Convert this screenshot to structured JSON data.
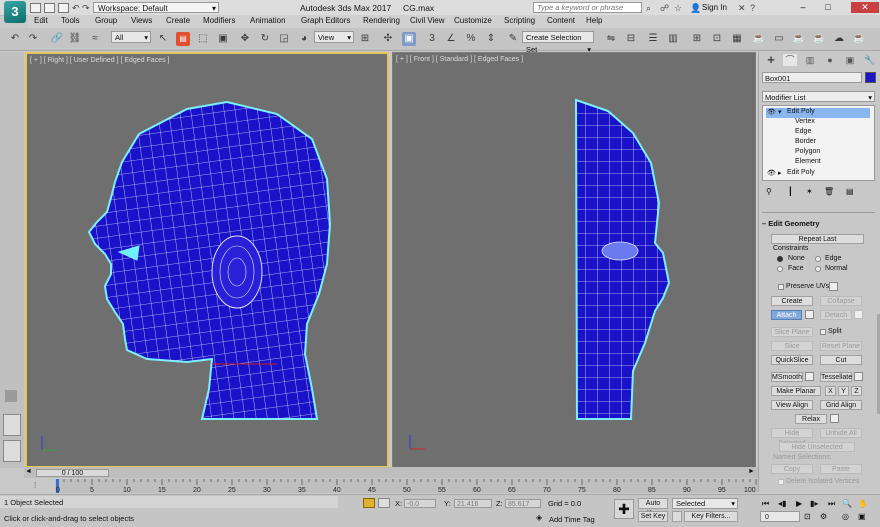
{
  "title_bar": {
    "workspace_label": "Workspace: Default",
    "app_title": "Autodesk 3ds Max 2017",
    "file_name": "CG.max",
    "search_placeholder": "Type a keyword or phrase",
    "sign_in": "Sign In"
  },
  "menu": [
    "Edit",
    "Tools",
    "Group",
    "Views",
    "Create",
    "Modifiers",
    "Animation",
    "Graph Editors",
    "Rendering",
    "Civil View",
    "Customize",
    "Scripting",
    "Content",
    "Help"
  ],
  "toolbar": {
    "filter_value": "All",
    "coord_system": "View",
    "selection_set_placeholder": "Create Selection Set"
  },
  "viewports": {
    "left_label": "[ + ] [ Right ] [ User Defined ] [ Edged Faces ]",
    "right_label": "[ + ] [ Front ] [ Standard ] [ Edged Faces ]"
  },
  "command_panel": {
    "object_name": "Box001",
    "object_color": "#1b14c8",
    "modifier_list": "Modifier List",
    "stack": [
      {
        "label": "Edit Poly",
        "level": 0,
        "selected": true
      },
      {
        "label": "Vertex",
        "level": 1
      },
      {
        "label": "Edge",
        "level": 1
      },
      {
        "label": "Border",
        "level": 1
      },
      {
        "label": "Polygon",
        "level": 1
      },
      {
        "label": "Element",
        "level": 1
      },
      {
        "label": "Edit Poly",
        "level": 0
      }
    ],
    "rollout_title": "Edit Geometry",
    "repeat_last": "Repeat Last",
    "constraints_label": "Constraints",
    "constraint_none": "None",
    "constraint_edge": "Edge",
    "constraint_face": "Face",
    "constraint_normal": "Normal",
    "preserve_uvs": "Preserve UVs",
    "create": "Create",
    "collapse": "Collapse",
    "attach": "Attach",
    "detach": "Detach",
    "slice_plane": "Slice Plane",
    "split": "Split",
    "slice": "Slice",
    "reset_plane": "Reset Plane",
    "quickslice": "QuickSlice",
    "cut": "Cut",
    "msmooth": "MSmooth",
    "tessellate": "Tessellate",
    "make_planar": "Make Planar",
    "x": "X",
    "y": "Y",
    "z": "Z",
    "view_align": "View Align",
    "grid_align": "Grid Align",
    "relax": "Relax",
    "hide_selected": "Hide Selected",
    "unhide_all": "Unhide All",
    "hide_unselected": "Hide Unselected",
    "named_selections": "Named Selections:",
    "copy": "Copy",
    "paste": "Paste",
    "delete_isolated": "Delete Isolated Vertices"
  },
  "timeline": {
    "frame_counter": "0 / 100",
    "ticks": [
      "0",
      "5",
      "10",
      "15",
      "20",
      "25",
      "30",
      "35",
      "40",
      "45",
      "50",
      "55",
      "60",
      "65",
      "70",
      "75",
      "80",
      "85",
      "90",
      "95",
      "100"
    ]
  },
  "status": {
    "selection": "1 Object Selected",
    "prompt": "Click or click-and-drag to select objects",
    "x_label": "X:",
    "x_value": "-0.0",
    "y_label": "Y:",
    "y_value": "21.416",
    "z_label": "Z:",
    "z_value": "85.617",
    "grid": "Grid = 0.0",
    "add_time_tag": "Add Time Tag",
    "auto_key": "Auto Key",
    "set_key": "Set Key",
    "key_mode": "Selected",
    "key_filters": "Key Filters...",
    "current_frame": "0"
  },
  "colors": {
    "mesh": "#1a12c8",
    "selection_outline": "#7af0ff",
    "active_viewport": "#e2c65a"
  }
}
